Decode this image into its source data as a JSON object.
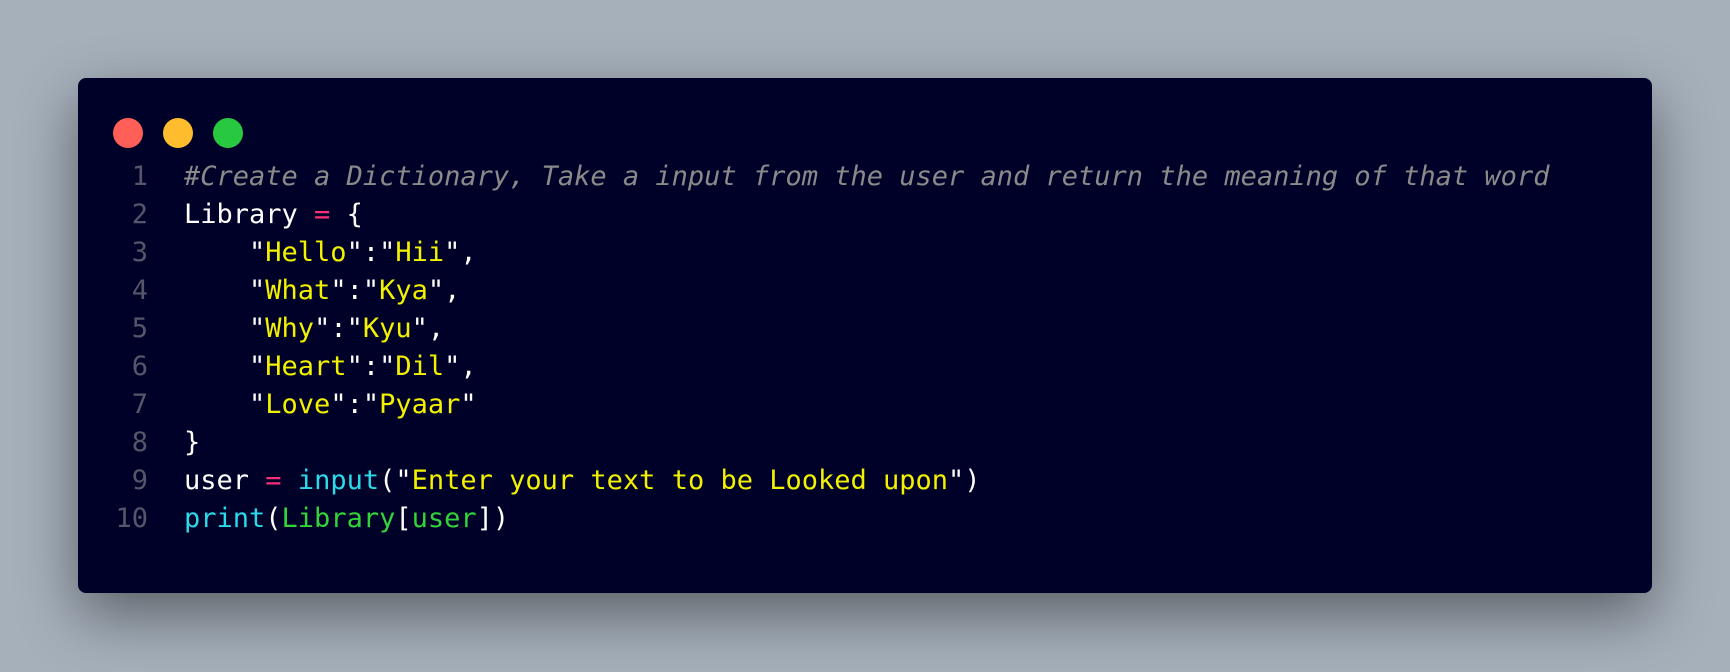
{
  "window": {
    "controls": [
      {
        "name": "close",
        "color": "#ff5f57"
      },
      {
        "name": "minimize",
        "color": "#ffbd2e"
      },
      {
        "name": "maximize",
        "color": "#28c840"
      }
    ]
  },
  "code": {
    "language": "python",
    "lines": [
      {
        "number": "1",
        "tokens": [
          {
            "t": "#Create a Dictionary, Take a input from the user and return the meaning of that word",
            "k": "comment"
          }
        ]
      },
      {
        "number": "2",
        "tokens": [
          {
            "t": "Library ",
            "k": "plain"
          },
          {
            "t": "=",
            "k": "op"
          },
          {
            "t": " {",
            "k": "plain"
          }
        ]
      },
      {
        "number": "3",
        "tokens": [
          {
            "t": "    \"",
            "k": "plain"
          },
          {
            "t": "Hello",
            "k": "str"
          },
          {
            "t": "\":\"",
            "k": "plain"
          },
          {
            "t": "Hii",
            "k": "str"
          },
          {
            "t": "\",",
            "k": "plain"
          }
        ]
      },
      {
        "number": "4",
        "tokens": [
          {
            "t": "    \"",
            "k": "plain"
          },
          {
            "t": "What",
            "k": "str"
          },
          {
            "t": "\":\"",
            "k": "plain"
          },
          {
            "t": "Kya",
            "k": "str"
          },
          {
            "t": "\",",
            "k": "plain"
          }
        ]
      },
      {
        "number": "5",
        "tokens": [
          {
            "t": "    \"",
            "k": "plain"
          },
          {
            "t": "Why",
            "k": "str"
          },
          {
            "t": "\":\"",
            "k": "plain"
          },
          {
            "t": "Kyu",
            "k": "str"
          },
          {
            "t": "\",",
            "k": "plain"
          }
        ]
      },
      {
        "number": "6",
        "tokens": [
          {
            "t": "    \"",
            "k": "plain"
          },
          {
            "t": "Heart",
            "k": "str"
          },
          {
            "t": "\":\"",
            "k": "plain"
          },
          {
            "t": "Dil",
            "k": "str"
          },
          {
            "t": "\",",
            "k": "plain"
          }
        ]
      },
      {
        "number": "7",
        "tokens": [
          {
            "t": "    \"",
            "k": "plain"
          },
          {
            "t": "Love",
            "k": "str"
          },
          {
            "t": "\":\"",
            "k": "plain"
          },
          {
            "t": "Pyaar",
            "k": "str"
          },
          {
            "t": "\"",
            "k": "plain"
          }
        ]
      },
      {
        "number": "8",
        "tokens": [
          {
            "t": "}",
            "k": "plain"
          }
        ]
      },
      {
        "number": "9",
        "tokens": [
          {
            "t": "user ",
            "k": "plain"
          },
          {
            "t": "=",
            "k": "op"
          },
          {
            "t": " ",
            "k": "plain"
          },
          {
            "t": "input",
            "k": "builtin"
          },
          {
            "t": "(\"",
            "k": "plain"
          },
          {
            "t": "Enter your text to be Looked upon",
            "k": "str"
          },
          {
            "t": "\")",
            "k": "plain"
          }
        ]
      },
      {
        "number": "10",
        "tokens": [
          {
            "t": "print",
            "k": "builtin"
          },
          {
            "t": "(",
            "k": "plain"
          },
          {
            "t": "Library",
            "k": "name"
          },
          {
            "t": "[",
            "k": "plain"
          },
          {
            "t": "user",
            "k": "name"
          },
          {
            "t": "])",
            "k": "plain"
          }
        ]
      }
    ]
  }
}
